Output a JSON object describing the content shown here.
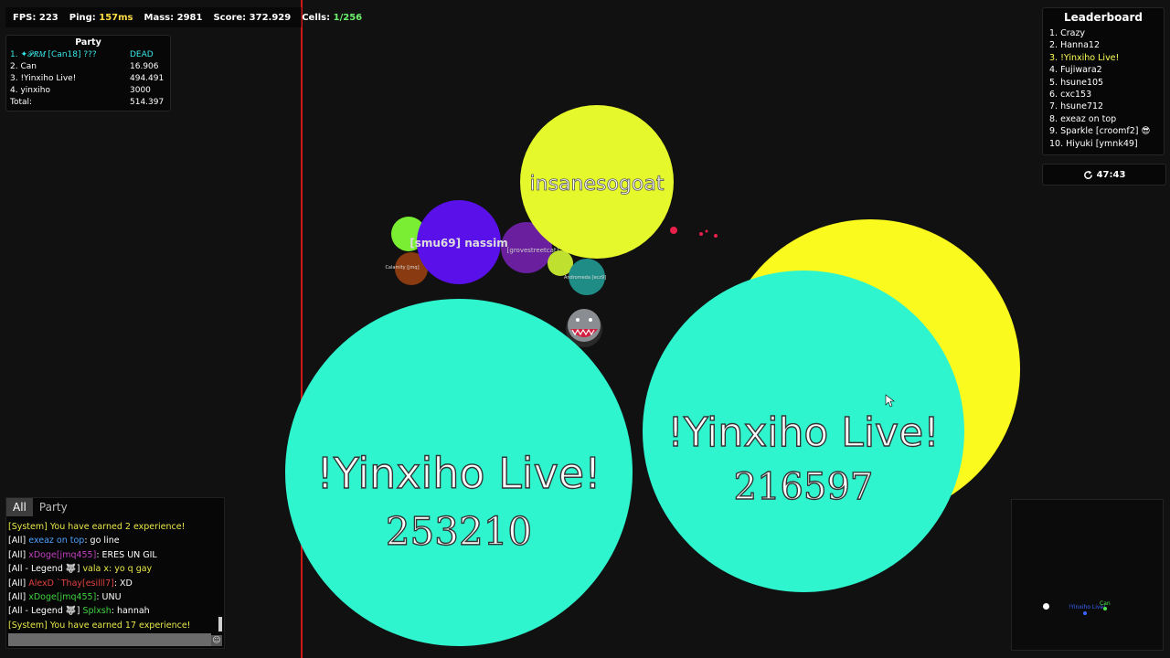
{
  "stats": {
    "fps_label": "FPS:",
    "fps": "223",
    "ping_label": "Ping:",
    "ping": "157ms",
    "mass_label": "Mass:",
    "mass": "2981",
    "score_label": "Score:",
    "score": "372.929",
    "cells_label": "Cells:",
    "cells": "1/256"
  },
  "party": {
    "title": "Party",
    "members": [
      {
        "name": "1. ✦𝒫𝑅𝑀 [Can18] ???",
        "score": "DEAD",
        "color": "#38e8e8"
      },
      {
        "name": "2. Can",
        "score": "16.906",
        "color": "#ffffff"
      },
      {
        "name": "3. !Yinxiho Live!",
        "score": "494.491",
        "color": "#ffffff"
      },
      {
        "name": "4. yinxiho",
        "score": "3000",
        "color": "#ffffff"
      }
    ],
    "total_label": "Total:",
    "total": "514.397"
  },
  "leaderboard": {
    "title": "Leaderboard",
    "entries": [
      {
        "text": "1. Crazy",
        "color": "#ffffff"
      },
      {
        "text": "2. Hanna12",
        "color": "#ffffff"
      },
      {
        "text": "3. !Yinxiho Live!",
        "color": "#ffff55"
      },
      {
        "text": "4. Fujiwara2",
        "color": "#ffffff"
      },
      {
        "text": "5. hsune105",
        "color": "#ffffff"
      },
      {
        "text": "6. cxc153",
        "color": "#ffffff"
      },
      {
        "text": "7. hsune712",
        "color": "#ffffff"
      },
      {
        "text": "8. exeaz on top",
        "color": "#ffffff"
      },
      {
        "text": "9. Sparkle [croomf2] 😎",
        "color": "#ffffff"
      },
      {
        "text": "10. Hiyuki [ymnk49]",
        "color": "#ffffff"
      }
    ]
  },
  "timer": {
    "icon": "refresh-icon",
    "value": "47:43"
  },
  "chat": {
    "tabs": [
      "All",
      "Party"
    ],
    "messages": [
      {
        "prefix": "[System] You have earned 2 experience!",
        "prefix_color": "#e8e84a",
        "name": "",
        "name_color": "",
        "text": ""
      },
      {
        "prefix": "[All] ",
        "prefix_color": "#ffffff",
        "name": "exeaz on top",
        "name_color": "#4aa0ff",
        "text": ": go line"
      },
      {
        "prefix": "[All] ",
        "prefix_color": "#ffffff",
        "name": "xDoge[jmq455]",
        "name_color": "#c040c0",
        "text": ": ERES UN GIL"
      },
      {
        "prefix": "[All - Legend 🐺] ",
        "prefix_color": "#ffffff",
        "name": "vala x",
        "name_color": "#e8e84a",
        "text": ": yo q gay"
      },
      {
        "prefix": "[All] ",
        "prefix_color": "#ffffff",
        "name": "AlexD `Thay[esilll7]",
        "name_color": "#e04040",
        "text": ": XD"
      },
      {
        "prefix": "[All] ",
        "prefix_color": "#ffffff",
        "name": "xDoge[jmq455]",
        "name_color": "#40d040",
        "text": ": UNU"
      },
      {
        "prefix": "[All - Legend 🐺] ",
        "prefix_color": "#ffffff",
        "name": "Splxsh",
        "name_color": "#40d040",
        "text": ": hannah"
      },
      {
        "prefix": "[System] You have earned 17 experience!",
        "prefix_color": "#e8e84a",
        "name": "",
        "name_color": "",
        "text": ""
      }
    ]
  },
  "cells": [
    {
      "name": "insanesogoat",
      "mass": "",
      "color": "#e5f82c"
    },
    {
      "name": "[smu69] nassim",
      "mass": "",
      "color": "#5a10e8"
    },
    {
      "name": "[grovestreetcat]",
      "mass": "",
      "color": "#6a1f9e"
    },
    {
      "name": "Calamity [jmq]",
      "mass": "",
      "color": "#8a3a10"
    },
    {
      "name": "Andromeda [ecz9]",
      "mass": "",
      "color": "#1f8c86"
    },
    {
      "name": "!Yinxiho Live!",
      "mass": "253210",
      "color": "#2ff5cf"
    },
    {
      "name": "!Yinxiho Live!",
      "mass": "216597",
      "color": "#2ff5cf"
    },
    {
      "name": "",
      "mass": "",
      "color": "#fafa1e"
    },
    {
      "name": "",
      "mass": "",
      "color": "#7aee32"
    }
  ],
  "minimap": {
    "labels": [
      {
        "text": "!Yinxiho Live!",
        "color": "#3a66ff"
      },
      {
        "text": "Can",
        "color": "#4ae84a"
      }
    ]
  },
  "colors": {
    "border": "#d01818",
    "background": "#111111",
    "food": "#e8204a"
  }
}
